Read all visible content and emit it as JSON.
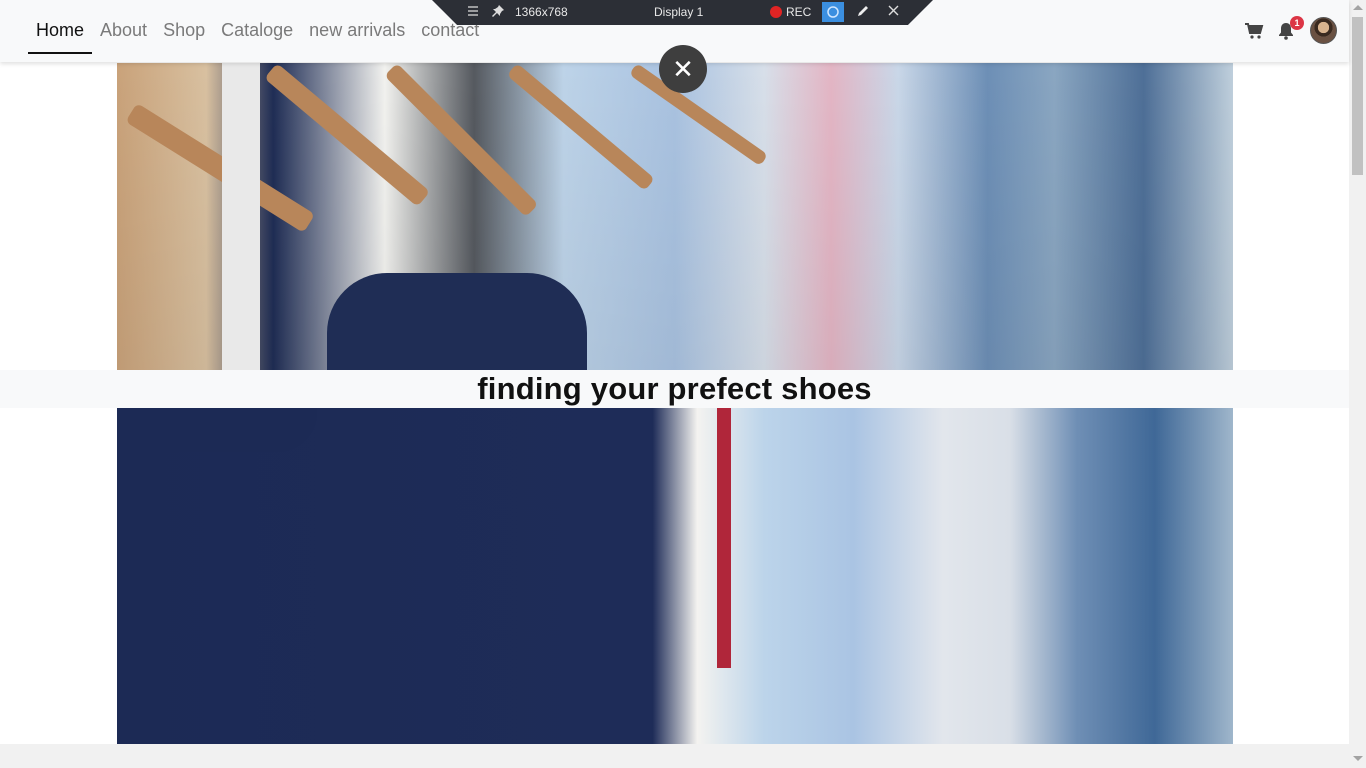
{
  "navbar": {
    "links": [
      {
        "label": "Home",
        "active": true
      },
      {
        "label": "About"
      },
      {
        "label": "Shop"
      },
      {
        "label": "Cataloge"
      },
      {
        "label": "new arrivals"
      },
      {
        "label": "contact"
      }
    ],
    "icons": {
      "cart": "cart-icon",
      "bell": "bell-icon",
      "avatar": "avatar"
    },
    "notification_count": "1"
  },
  "recorder": {
    "resolution": "1366x768",
    "display": "Display 1",
    "rec_label": "REC"
  },
  "hero": {
    "caption": "finding your prefect shoes",
    "close_symbol": "✕"
  },
  "colors": {
    "accent": "#dc3545",
    "navbar_bg": "#f8f9fa",
    "text_dark": "#111111"
  }
}
